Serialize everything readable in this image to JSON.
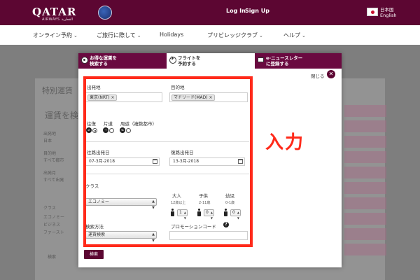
{
  "header": {
    "logo_text": "QATAR",
    "logo_sub": "AIRWAYS القطرية",
    "login": "Log In",
    "signup": "Sign Up",
    "lang_line1": "日本国",
    "lang_line2": "English"
  },
  "nav": {
    "items": [
      {
        "label": "オンライン予約",
        "chevron": "⌄"
      },
      {
        "label": "ご旅行に際して",
        "chevron": "⌄"
      },
      {
        "label": "Holidays",
        "chevron": ""
      },
      {
        "label": "プリビレッジクラブ",
        "chevron": "⌄"
      },
      {
        "label": "ヘルプ",
        "chevron": "⌄"
      }
    ]
  },
  "background": {
    "title": "特別運賃",
    "subtitle": "運賃を検",
    "left_labels": [
      "出発地",
      "日本",
      "目的地",
      "すべて都市",
      "出発月",
      "すべて出発",
      "クラス",
      "エコノミー",
      "ビジネス",
      "ファースト"
    ],
    "search": "検索"
  },
  "modal": {
    "tabs": {
      "offers_line1": "お得な運賃を",
      "offers_line2": "検索する",
      "flight_line1": "フライトを",
      "flight_line2": "予約する",
      "news_line1": "e-ニュースレター",
      "news_line2": "に登録する"
    },
    "close_text": "閉じる",
    "close_symbol": "✕",
    "origin": {
      "label": "出発地",
      "value": "東京(NRT)",
      "remove": "×"
    },
    "destination": {
      "label": "目的地",
      "value": "マドリード(MAD)",
      "remove": "×"
    },
    "trip_type": {
      "round_trip": "往復",
      "one_way": "片道",
      "multi_city": "周遊（複数都市）",
      "selected": "round_trip"
    },
    "depart_date": {
      "label": "往路出発日",
      "value": "07-3月-2018"
    },
    "return_date": {
      "label": "復路出発日",
      "value": "13-3月-2018"
    },
    "class": {
      "label": "クラス",
      "value": "エコノミー"
    },
    "passengers": {
      "adult_label": "大人",
      "adult_sub": "12歳以上",
      "adult_count": "1",
      "child_label": "子供",
      "child_sub": "2-11歳",
      "child_count": "0",
      "infant_label": "幼児",
      "infant_sub": "0-1歳",
      "infant_count": "0"
    },
    "search_method": {
      "label": "検索方法",
      "value": "運賃検索"
    },
    "promo": {
      "label": "プロモーションコード",
      "help": "?"
    },
    "search_button": "検索"
  },
  "annotation": {
    "text": "入力",
    "color": "#ff2a1a"
  },
  "colors": {
    "brand": "#5c0632",
    "tab_active_bg": "#ffffff",
    "tab_inactive_bg": "#6a0a40"
  }
}
